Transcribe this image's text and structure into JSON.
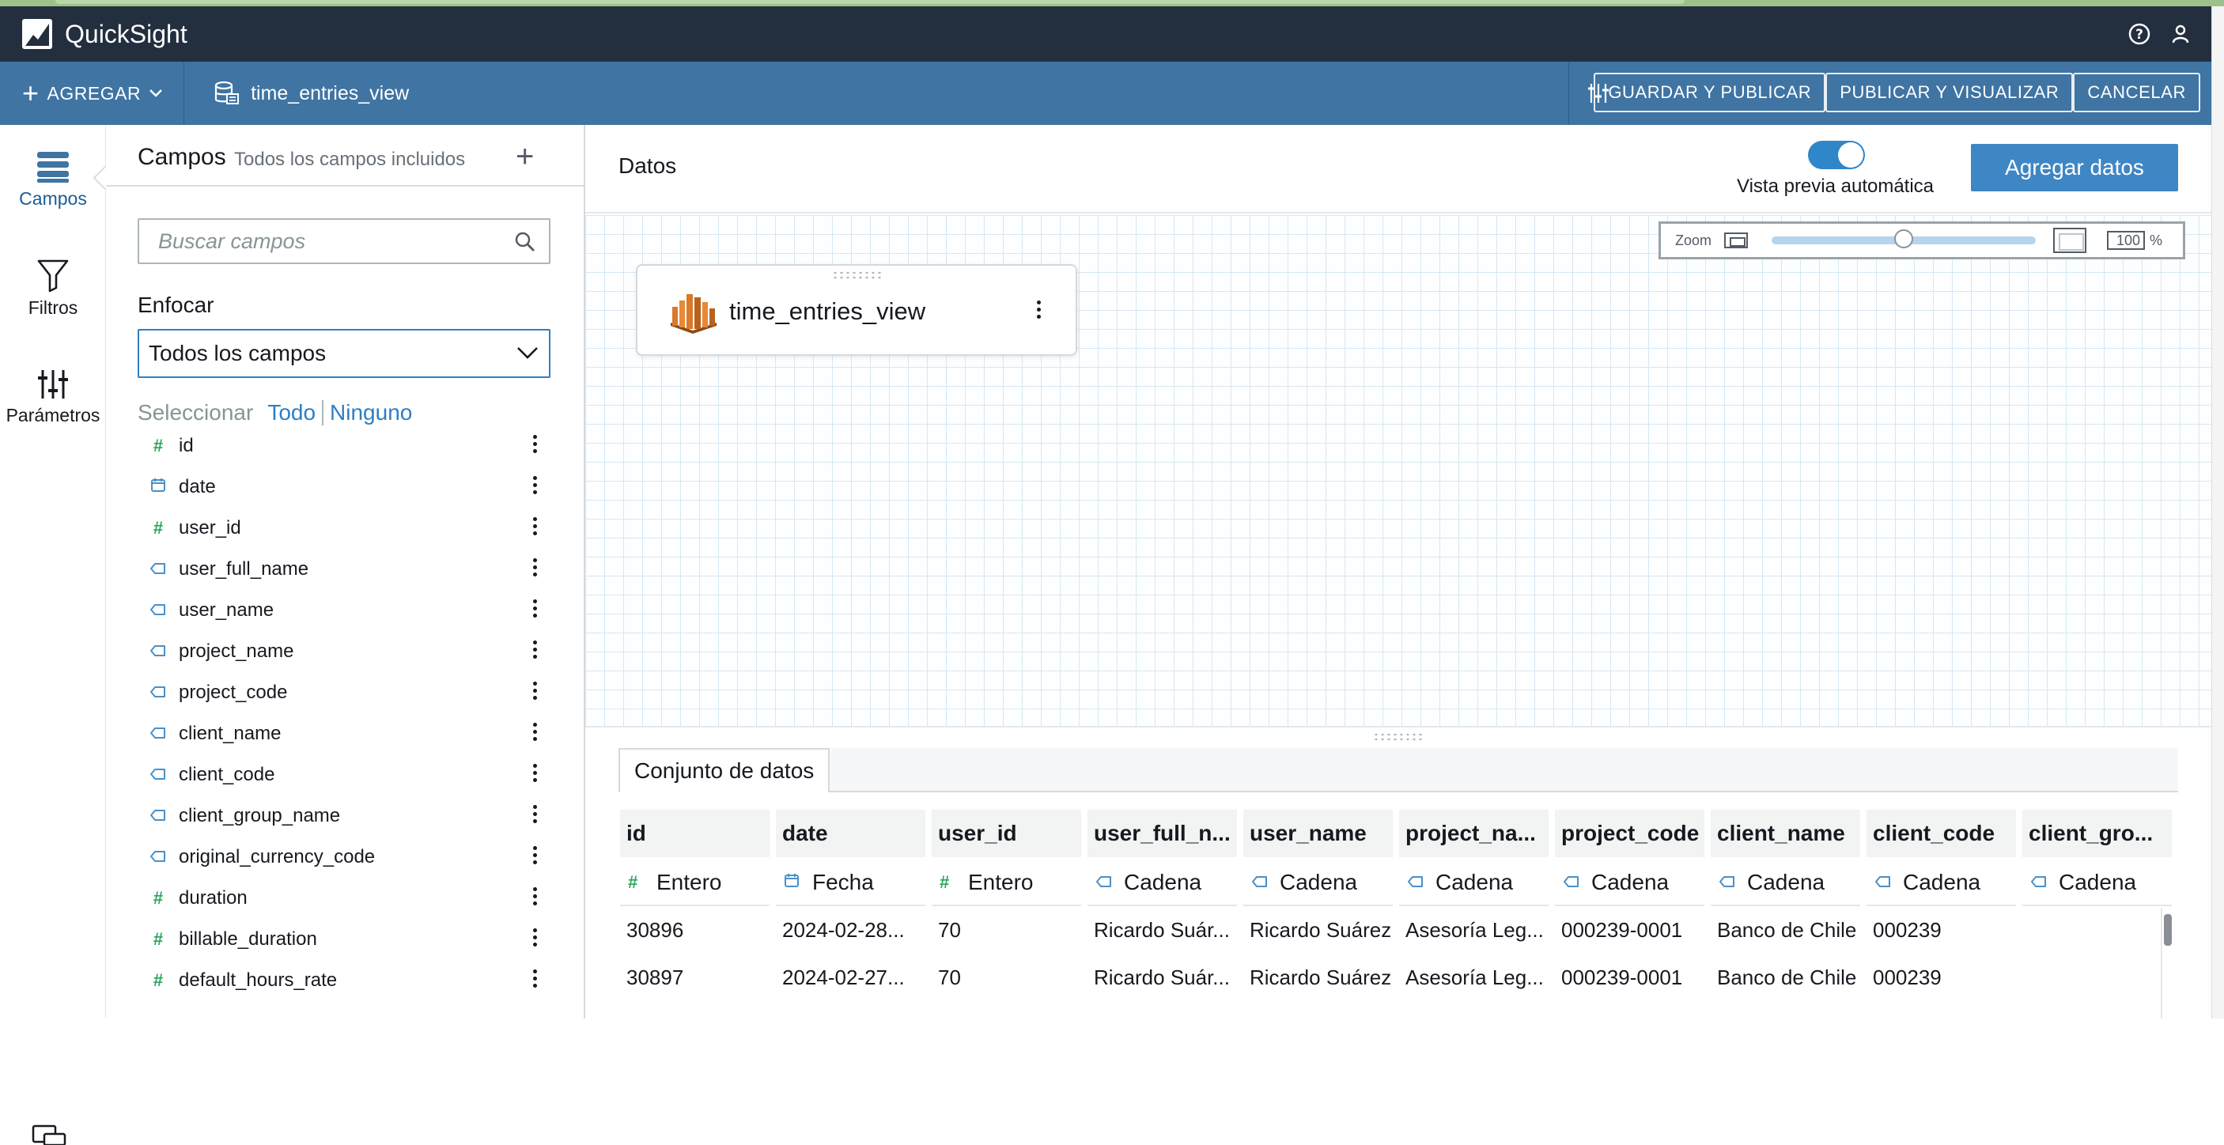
{
  "app": {
    "name": "QuickSight"
  },
  "toolbar": {
    "add_label": "AGREGAR",
    "dataset_name": "time_entries_view",
    "save_publish": "GUARDAR Y PUBLICAR",
    "publish_view": "PUBLICAR Y VISUALIZAR",
    "cancel": "CANCELAR"
  },
  "leftnav": {
    "items": [
      {
        "label": "Campos",
        "icon": "fields-icon"
      },
      {
        "label": "Filtros",
        "icon": "filter-icon"
      },
      {
        "label": "Parámetros",
        "icon": "parameters-icon"
      }
    ]
  },
  "fields_panel": {
    "title": "Campos",
    "subtitle": "Todos los campos incluidos",
    "search_placeholder": "Buscar campos",
    "focus_label": "Enfocar",
    "focus_value": "Todos los campos",
    "select_label": "Seleccionar",
    "select_all": "Todo",
    "select_none": "Ninguno",
    "fields": [
      {
        "name": "id",
        "type": "number"
      },
      {
        "name": "date",
        "type": "date"
      },
      {
        "name": "user_id",
        "type": "number"
      },
      {
        "name": "user_full_name",
        "type": "string"
      },
      {
        "name": "user_name",
        "type": "string"
      },
      {
        "name": "project_name",
        "type": "string"
      },
      {
        "name": "project_code",
        "type": "string"
      },
      {
        "name": "client_name",
        "type": "string"
      },
      {
        "name": "client_code",
        "type": "string"
      },
      {
        "name": "client_group_name",
        "type": "string"
      },
      {
        "name": "original_currency_code",
        "type": "string"
      },
      {
        "name": "duration",
        "type": "number"
      },
      {
        "name": "billable_duration",
        "type": "number"
      },
      {
        "name": "default_hours_rate",
        "type": "number"
      }
    ]
  },
  "canvas": {
    "title": "Datos",
    "autopreview_label": "Vista previa automática",
    "autopreview_on": true,
    "add_data_label": "Agregar datos",
    "zoom_label": "Zoom",
    "zoom_value": "100",
    "zoom_unit": "%",
    "node_title": "time_entries_view"
  },
  "dataset_tab": "Conjunto de datos",
  "table": {
    "columns": [
      {
        "header": "id",
        "type_label": "Entero",
        "type": "number"
      },
      {
        "header": "date",
        "type_label": "Fecha",
        "type": "date"
      },
      {
        "header": "user_id",
        "type_label": "Entero",
        "type": "number"
      },
      {
        "header": "user_full_n...",
        "type_label": "Cadena",
        "type": "string"
      },
      {
        "header": "user_name",
        "type_label": "Cadena",
        "type": "string"
      },
      {
        "header": "project_na...",
        "type_label": "Cadena",
        "type": "string"
      },
      {
        "header": "project_code",
        "type_label": "Cadena",
        "type": "string"
      },
      {
        "header": "client_name",
        "type_label": "Cadena",
        "type": "string"
      },
      {
        "header": "client_code",
        "type_label": "Cadena",
        "type": "string"
      },
      {
        "header": "client_gro...",
        "type_label": "Cadena",
        "type": "string"
      }
    ],
    "rows": [
      [
        "30896",
        "2024-02-28...",
        "70",
        "Ricardo Suár...",
        "Ricardo Suárez",
        "Asesoría Leg...",
        "000239-0001",
        "Banco de Chile",
        "000239",
        ""
      ],
      [
        "30897",
        "2024-02-27...",
        "70",
        "Ricardo Suár...",
        "Ricardo Suárez",
        "Asesoría Leg...",
        "000239-0001",
        "Banco de Chile",
        "000239",
        ""
      ]
    ]
  },
  "colors": {
    "appbar": "#232f3e",
    "toolbar": "#3f74a3",
    "accent": "#3f86c4",
    "number_type": "#29a55c",
    "string_type": "#4a90c8"
  }
}
